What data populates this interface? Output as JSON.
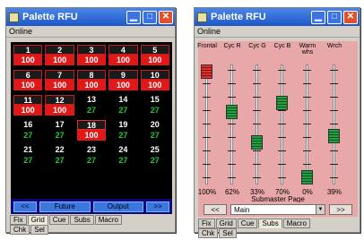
{
  "grid_window": {
    "title": "Palette RFU",
    "menu": "Online",
    "cells": [
      {
        "num": "1",
        "val": "100",
        "state": "on"
      },
      {
        "num": "2",
        "val": "100",
        "state": "on"
      },
      {
        "num": "3",
        "val": "100",
        "state": "on"
      },
      {
        "num": "4",
        "val": "100",
        "state": "on"
      },
      {
        "num": "5",
        "val": "100",
        "state": "on"
      },
      {
        "num": "6",
        "val": "100",
        "state": "on"
      },
      {
        "num": "7",
        "val": "100",
        "state": "on"
      },
      {
        "num": "8",
        "val": "100",
        "state": "on"
      },
      {
        "num": "9",
        "val": "100",
        "state": "on"
      },
      {
        "num": "10",
        "val": "100",
        "state": "on"
      },
      {
        "num": "11",
        "val": "100",
        "state": "on"
      },
      {
        "num": "12",
        "val": "100",
        "state": "on"
      },
      {
        "num": "13",
        "val": "27",
        "state": "off"
      },
      {
        "num": "14",
        "val": "27",
        "state": "off"
      },
      {
        "num": "15",
        "val": "27",
        "state": "off"
      },
      {
        "num": "16",
        "val": "27",
        "state": "off"
      },
      {
        "num": "17",
        "val": "27",
        "state": "off"
      },
      {
        "num": "18",
        "val": "100",
        "state": "on"
      },
      {
        "num": "19",
        "val": "27",
        "state": "off"
      },
      {
        "num": "20",
        "val": "27",
        "state": "off"
      },
      {
        "num": "21",
        "val": "27",
        "state": "off"
      },
      {
        "num": "22",
        "val": "27",
        "state": "off"
      },
      {
        "num": "23",
        "val": "27",
        "state": "off"
      },
      {
        "num": "24",
        "val": "27",
        "state": "off"
      },
      {
        "num": "25",
        "val": "27",
        "state": "off"
      }
    ],
    "buttons": {
      "prev": "<<",
      "future": "Future",
      "output": "Output",
      "next": ">>"
    },
    "tabs_row1": [
      "Fix",
      "Grid",
      "Cue",
      "Subs",
      "Macro"
    ],
    "tabs_row2": [
      "Chk",
      "Sel"
    ],
    "selected_tab": "Grid"
  },
  "fader_window": {
    "title": "Palette RFU",
    "menu": "Online",
    "faders": [
      {
        "label": "Frontal",
        "pct": "100%",
        "level": 100,
        "color": "red"
      },
      {
        "label": "Cyc R",
        "pct": "62%",
        "level": 62,
        "color": "green"
      },
      {
        "label": "Cyc G",
        "pct": "33%",
        "level": 33,
        "color": "green"
      },
      {
        "label": "Cyc B",
        "pct": "70%",
        "level": 70,
        "color": "green"
      },
      {
        "label": "Warm whs",
        "pct": "0%",
        "level": 0,
        "color": "green"
      },
      {
        "label": "Wrch",
        "pct": "39%",
        "level": 39,
        "color": "green"
      }
    ],
    "page_label": "Submaster Page",
    "prev": "<<",
    "next": ">>",
    "page_value": "Main",
    "tabs_row1": [
      "Fix",
      "Grid",
      "Cue",
      "Subs",
      "Macro"
    ],
    "tabs_row2": [
      "Chk",
      "Sel"
    ],
    "selected_tab": "Subs"
  }
}
